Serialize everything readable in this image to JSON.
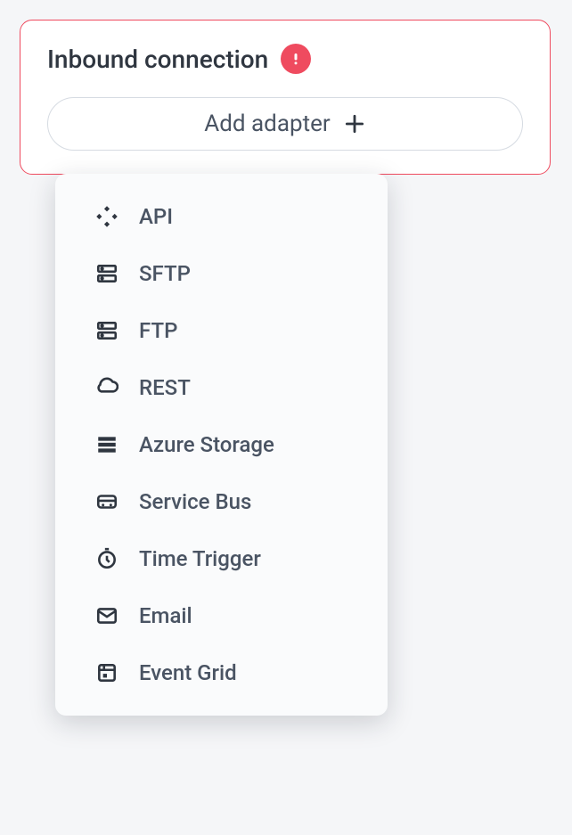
{
  "card": {
    "title": "Inbound connection",
    "add_button_label": "Add adapter"
  },
  "menu": {
    "items": [
      {
        "icon": "api-icon",
        "label": "API"
      },
      {
        "icon": "sftp-icon",
        "label": "SFTP"
      },
      {
        "icon": "ftp-icon",
        "label": "FTP"
      },
      {
        "icon": "rest-icon",
        "label": "REST"
      },
      {
        "icon": "storage-icon",
        "label": "Azure Storage"
      },
      {
        "icon": "servicebus-icon",
        "label": "Service Bus"
      },
      {
        "icon": "timetrigger-icon",
        "label": "Time Trigger"
      },
      {
        "icon": "email-icon",
        "label": "Email"
      },
      {
        "icon": "eventgrid-icon",
        "label": "Event Grid"
      }
    ]
  }
}
